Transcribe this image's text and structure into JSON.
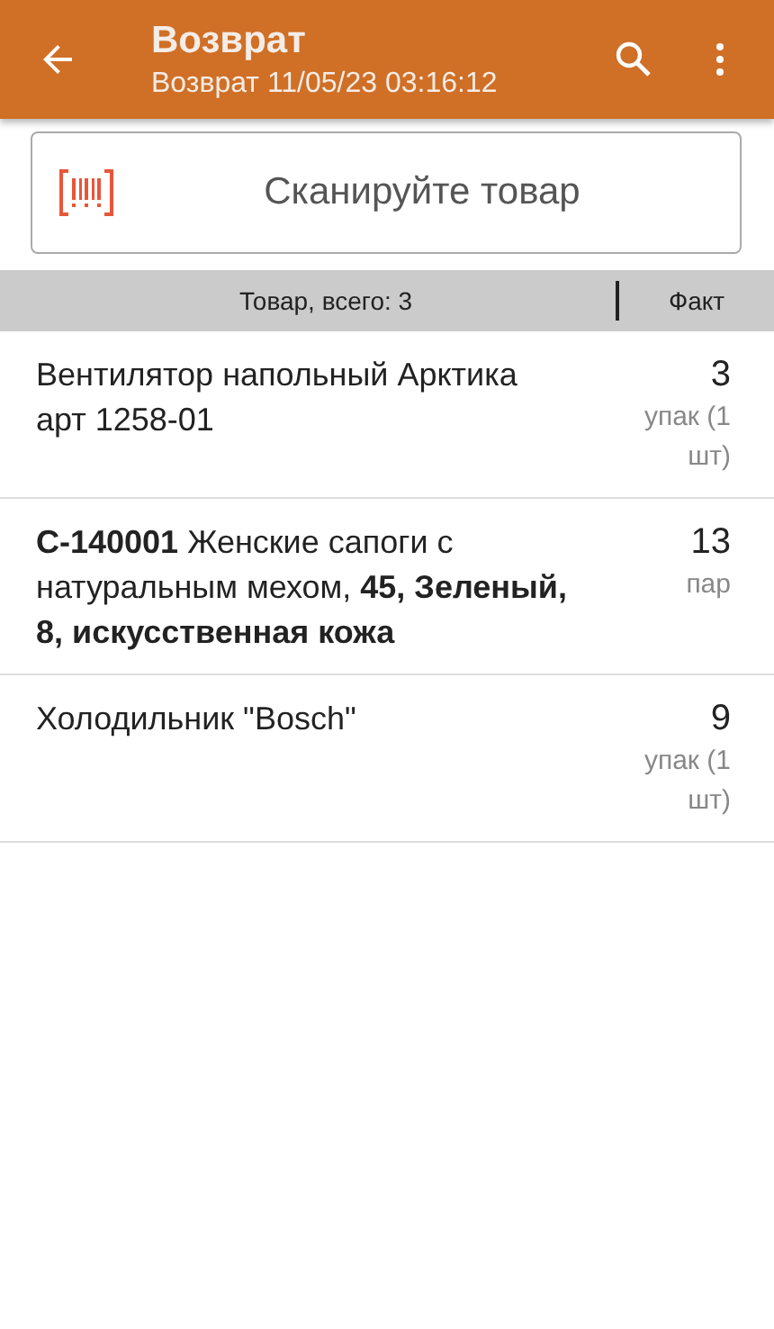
{
  "toolbar": {
    "title": "Возврат",
    "subtitle": "Возврат 11/05/23 03:16:12"
  },
  "scan": {
    "placeholder": "Сканируйте товар"
  },
  "table": {
    "columns": [
      "Товар, всего: 3",
      "Факт"
    ],
    "rows": [
      {
        "name": "Вентилятор напольный Арктика арт 1258-01",
        "qty": "3",
        "unit": "упак (1 шт)"
      },
      {
        "name": "**C-140001** Женские сапоги с натуральным мехом, **45, Зеленый, 8, искусственная кожа**",
        "qty": "13",
        "unit": "пар"
      },
      {
        "name": "Холодильник \"Bosch\"",
        "qty": "9",
        "unit": "упак (1 шт)"
      }
    ]
  }
}
